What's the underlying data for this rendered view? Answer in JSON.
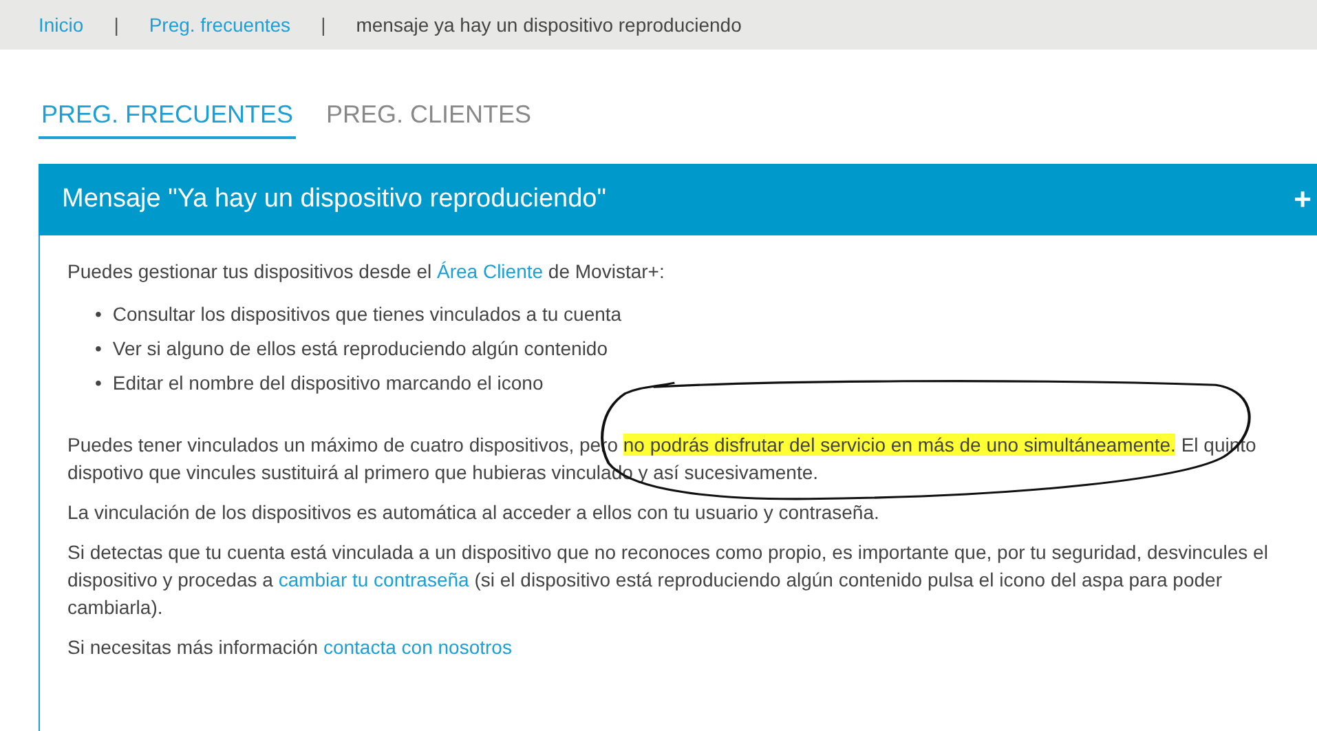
{
  "breadcrumb": [
    {
      "label": "Inicio",
      "kind": "link"
    },
    {
      "label": "Preg. frecuentes",
      "kind": "link"
    },
    {
      "label": "mensaje ya hay un dispositivo reproduciendo",
      "kind": "current"
    }
  ],
  "breadcrumb_separator": "|",
  "tabs": [
    {
      "label": "PREG. FRECUENTES",
      "selected": true
    },
    {
      "label": "PREG. CLIENTES",
      "selected": false
    }
  ],
  "panel": {
    "title": "Mensaje \"Ya hay un dispositivo reproduciendo\"",
    "toggle": "+",
    "blocks": [
      {
        "kind": "paragraph",
        "segments": [
          {
            "kind": "text",
            "text": "Puedes gestionar tus dispositivos desde el "
          },
          {
            "kind": "link",
            "text": "Área Cliente"
          },
          {
            "kind": "text",
            "text": " de Movistar+:"
          }
        ]
      },
      {
        "kind": "list",
        "bullet": "•",
        "items": [
          "Consultar los dispositivos que tienes vinculados a tu cuenta",
          "Ver si alguno de ellos está reproduciendo algún contenido",
          "Editar el nombre del dispositivo marcando el icono"
        ]
      },
      {
        "kind": "paragraph",
        "segments": [
          {
            "kind": "text",
            "text": "Puedes tener vinculados un máximo de cuatro dispositivos, pero "
          },
          {
            "kind": "highlight",
            "text": "no podrás disfrutar del servicio en más de uno simultáneamente."
          },
          {
            "kind": "text",
            "text": " El quinto dispotivo que vincules sustituirá al primero que hubieras vinculado y así sucesivamente."
          }
        ]
      },
      {
        "kind": "paragraph",
        "segments": [
          {
            "kind": "text",
            "text": "La vinculación de los dispositivos es automática al acceder a ellos con tu usuario y contraseña."
          }
        ]
      },
      {
        "kind": "paragraph",
        "segments": [
          {
            "kind": "text",
            "text": "Si detectas que tu cuenta está vinculada a un dispositivo que no reconoces como propio, es importante que, por tu seguridad, desvincules el dispositivo y procedas a "
          },
          {
            "kind": "link",
            "text": "cambiar tu contraseña"
          },
          {
            "kind": "text",
            "text": " (si el dispositivo está reproduciendo algún contenido pulsa el icono del aspa para poder cambiarla)."
          }
        ]
      },
      {
        "kind": "paragraph",
        "segments": [
          {
            "kind": "text",
            "text": "Si necesitas más información "
          },
          {
            "kind": "link",
            "text": "contacta con nosotros"
          }
        ]
      }
    ]
  }
}
